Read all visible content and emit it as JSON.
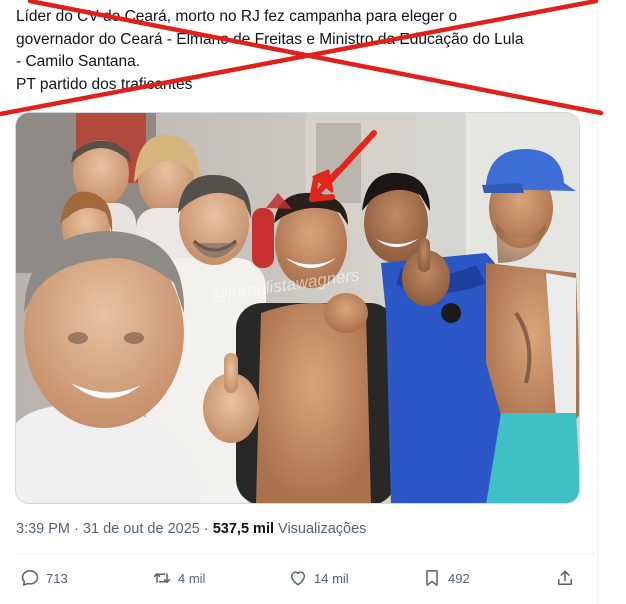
{
  "tweet": {
    "lines": [
      "Líder do CV do Ceará, morto no RJ fez campanha para eleger o",
      "governador do Ceará - Elmano de Freitas e Ministro da Educação do Lula",
      "- Camilo Santana.",
      "PT partido dos traficantes"
    ]
  },
  "media": {
    "watermark": "@jornalistawagners"
  },
  "meta": {
    "time": "3:39 PM",
    "separator": "·",
    "date": "31 de out de 2025",
    "views_count": "537,5 mil",
    "views_label": "Visualizações"
  },
  "actions": {
    "replies": "713",
    "reposts": "4 mil",
    "likes": "14 mil",
    "bookmarks": "492"
  },
  "colors": {
    "strike": "#e0201a",
    "arrow": "#e2261c",
    "muted_text": "#536471"
  }
}
